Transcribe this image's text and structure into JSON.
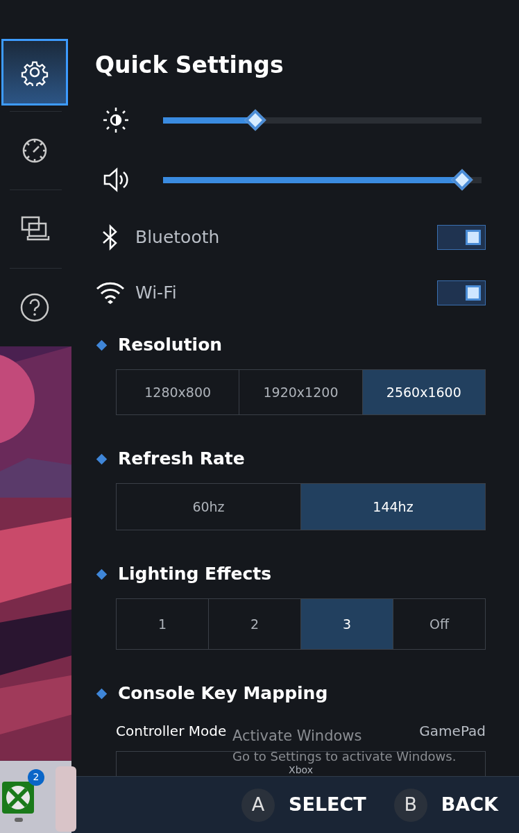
{
  "sidebar": {
    "items": [
      {
        "kind": "gear",
        "selected": true
      },
      {
        "kind": "gauge",
        "selected": false
      },
      {
        "kind": "display",
        "selected": false
      },
      {
        "kind": "help",
        "selected": false
      }
    ]
  },
  "taskbar": {
    "badge": "2"
  },
  "title": "Quick Settings",
  "sliders": [
    {
      "kind": "brightness",
      "level": 0.29
    },
    {
      "kind": "volume",
      "level": 0.94
    }
  ],
  "toggles": [
    {
      "kind": "bluetooth",
      "label": "Bluetooth",
      "on": true
    },
    {
      "kind": "wifi",
      "label": "Wi-Fi",
      "on": true
    }
  ],
  "sections": [
    {
      "title": "Resolution",
      "options": [
        {
          "label": "1280x800",
          "selected": false
        },
        {
          "label": "1920x1200",
          "selected": false
        },
        {
          "label": "2560x1600",
          "selected": true
        }
      ]
    },
    {
      "title": "Refresh Rate",
      "options": [
        {
          "label": "60hz",
          "selected": false
        },
        {
          "label": "144hz",
          "selected": true
        }
      ]
    },
    {
      "title": "Lighting Effects",
      "options": [
        {
          "label": "1",
          "selected": false
        },
        {
          "label": "2",
          "selected": false
        },
        {
          "label": "3",
          "selected": true
        },
        {
          "label": "Off",
          "selected": false
        }
      ]
    }
  ],
  "key_mapping": {
    "title": "Console Key Mapping",
    "label": "Controller Mode",
    "value": "GamePad",
    "dropdown": "Xbox"
  },
  "watermark": {
    "title": "Activate Windows",
    "text": "Go to Settings to activate Windows."
  },
  "footer": {
    "buttons": [
      {
        "key": "A",
        "label": "SELECT"
      },
      {
        "key": "B",
        "label": "BACK"
      }
    ]
  }
}
